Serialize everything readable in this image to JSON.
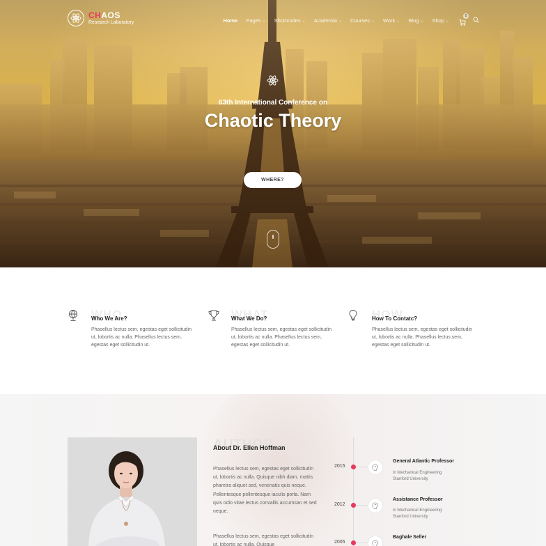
{
  "brand": {
    "name_accent": "CH",
    "name_rest": "AOS",
    "tagline": "Research Laboratory"
  },
  "nav": {
    "items": [
      {
        "label": "Home",
        "active": true,
        "dropdown": false
      },
      {
        "label": "Pages",
        "dropdown": true
      },
      {
        "label": "Shortcodes",
        "dropdown": true
      },
      {
        "label": "Academia",
        "dropdown": true
      },
      {
        "label": "Courses",
        "dropdown": true
      },
      {
        "label": "Work",
        "dropdown": true
      },
      {
        "label": "Blog",
        "dropdown": true
      },
      {
        "label": "Shop",
        "dropdown": true
      }
    ],
    "cart_icon": "cart-icon",
    "cart_count": "0",
    "search_icon": "search-icon"
  },
  "hero": {
    "icon": "atom-icon",
    "subtitle": "63th International Conference on",
    "title": "Chaotic Theory",
    "button_label": "WHERE?"
  },
  "features": [
    {
      "icon": "globe-icon",
      "bg_word": "WHO",
      "title": "Who We Are?",
      "text": "Phasellus lectus sem, egestas eget sollicitudin ut, lobortis ac nulla. Phasellus lectus sem, egestas eget sollicitudin ut."
    },
    {
      "icon": "trophy-icon",
      "bg_word": "WHAT",
      "title": "What We Do?",
      "text": "Phasellus lectus sem, egestas eget sollicitudin ut, lobortis ac nulla. Phasellus lectus sem, egestas eget sollicitudin ut."
    },
    {
      "icon": "lightbulb-icon",
      "bg_word": "HOW",
      "title": "How To Contatc?",
      "text": "Phasellus lectus sem, egestas eget sollicitudin ut, lobortis ac nulla. Phasellus lectus sem, egestas eget sollicitudin ut."
    }
  ],
  "author": {
    "bg_word": "AUTHOR",
    "title": "About Dr. Ellen Hoffman",
    "paragraphs": [
      "Phasellus lectus sem, egestas eget sollicitudin ut, lobortis ac nulla. Quisque nibh diam, mattis pharetra aliquet sed, venenatis quis neque. Pellentesque pellentesque iaculis porta. Nam quis odio vitae lectus convallis accumsan et sed neque.",
      "Phasellus lectus sem, egestas eget sollicitudin ut, lobortis ac nulla. Quisque"
    ]
  },
  "timeline": [
    {
      "year": "2015",
      "title": "General Atlantic Professor",
      "lines": [
        "in Mechanical Engineering",
        "Stanford University"
      ]
    },
    {
      "year": "2012",
      "title": "Assistance Professor",
      "lines": [
        "in Mechanical Engineering",
        "Stanford University"
      ]
    },
    {
      "year": "2005",
      "title": "Baghale Seller",
      "lines": []
    }
  ],
  "colors": {
    "accent": "#e8385d"
  }
}
